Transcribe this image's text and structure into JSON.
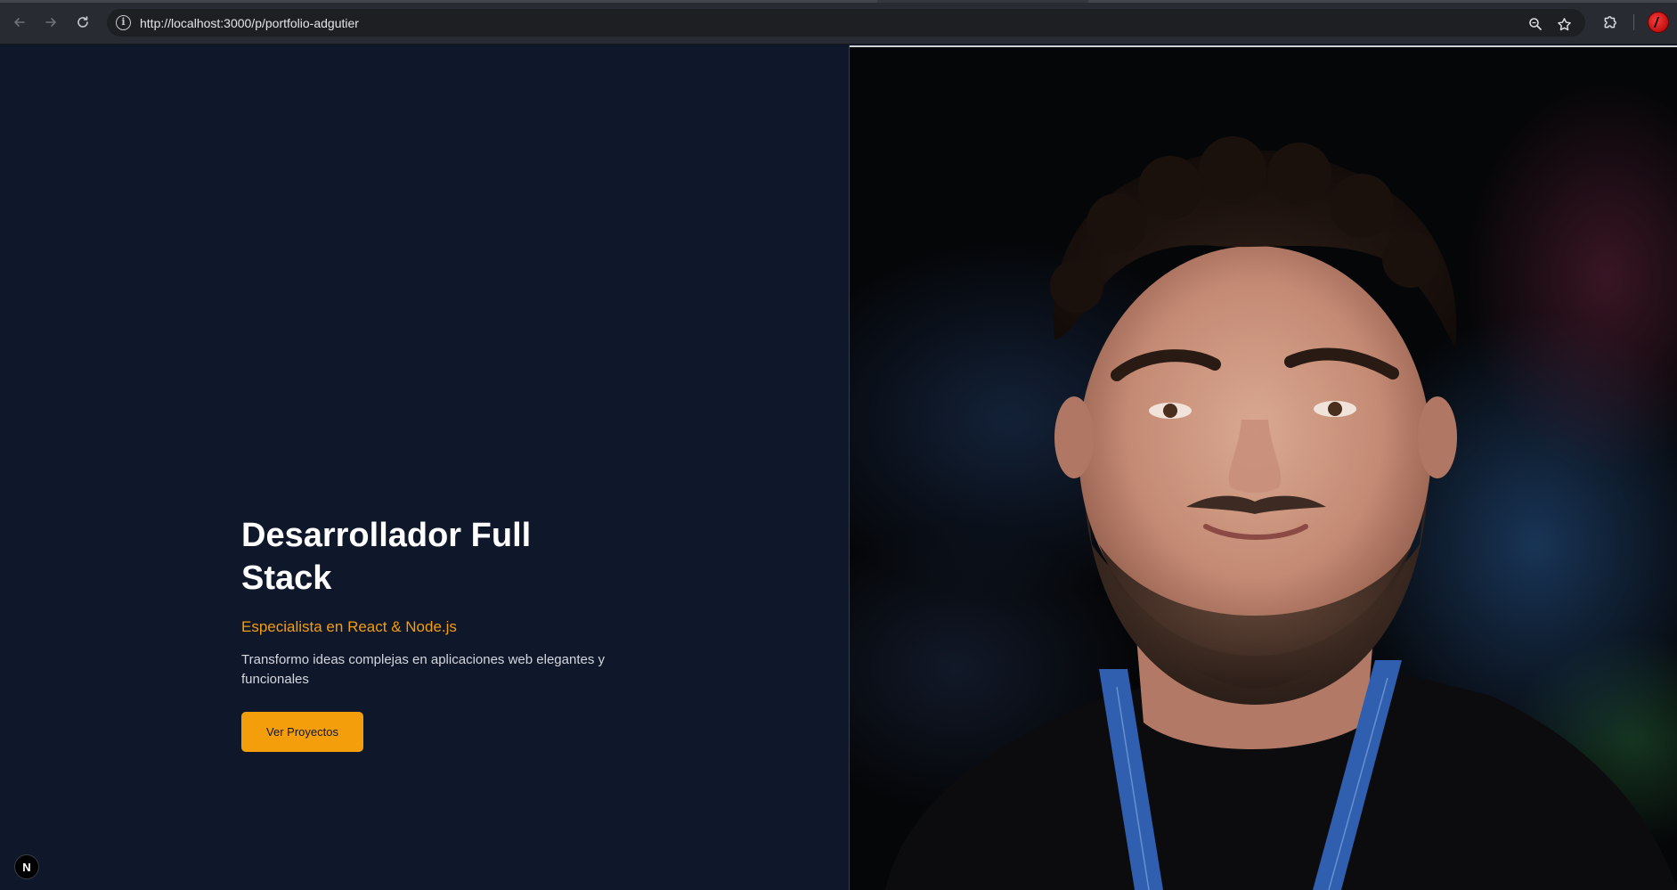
{
  "browser": {
    "url": "http://localhost:3000/p/portfolio-adgutier",
    "url_host": "localhost",
    "icons": {
      "back": "arrow-left-icon",
      "forward": "arrow-right-icon",
      "reload": "reload-icon",
      "site_info": "info-icon",
      "zoom": "zoom-icon",
      "bookmark": "star-icon",
      "extensions": "puzzle-icon",
      "profile": "profile-avatar"
    }
  },
  "hero": {
    "title": "Desarrollador Full Stack",
    "subtitle": "Especialista en React & Node.js",
    "description": "Transformo ideas complejas en aplicaciones web elegantes y funcionales",
    "cta_label": "Ver Proyectos"
  },
  "dev_badge": {
    "label": "N"
  },
  "colors": {
    "background": "#0f172a",
    "accent": "#f59e0b",
    "title": "#ffffff",
    "body_text": "#d4d7de"
  }
}
